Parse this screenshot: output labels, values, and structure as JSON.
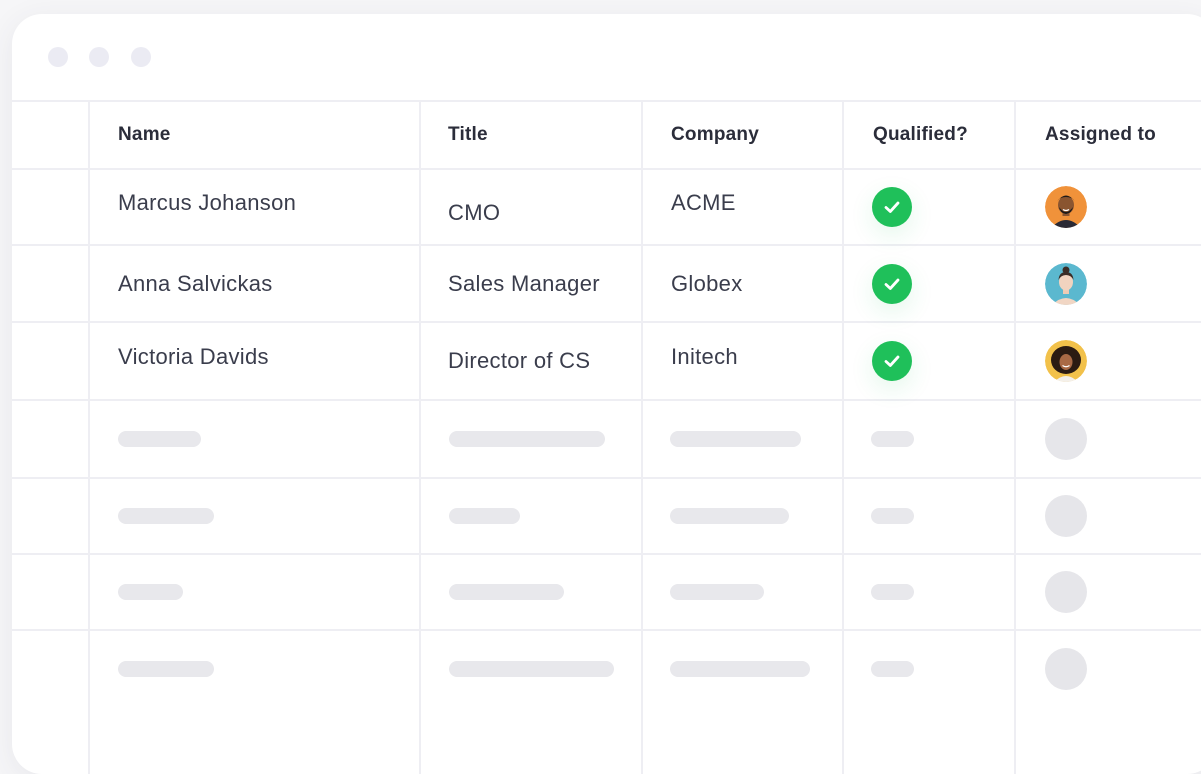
{
  "window": {
    "controls": [
      "close",
      "minimize",
      "maximize"
    ]
  },
  "table": {
    "columns": [
      "Name",
      "Title",
      "Company",
      "Qualified?",
      "Assigned to"
    ],
    "rows": [
      {
        "name": "Marcus Johanson",
        "title": "CMO",
        "company": "ACME",
        "qualified": true,
        "assigned_avatar": "avatar-man-orange-bg"
      },
      {
        "name": "Anna Salvickas",
        "title": "Sales Manager",
        "company": "Globex",
        "qualified": true,
        "assigned_avatar": "avatar-woman-teal-bg"
      },
      {
        "name": "Victoria Davids",
        "title": "Director of CS",
        "company": "Initech",
        "qualified": true,
        "assigned_avatar": "avatar-woman-yellow-bg"
      }
    ],
    "placeholder_rows": 4
  },
  "colors": {
    "check": "#1fc05a",
    "grid": "#eeeef3",
    "skeleton": "#e8e8ec"
  },
  "icons": {
    "qualified": "check-circle-icon"
  }
}
